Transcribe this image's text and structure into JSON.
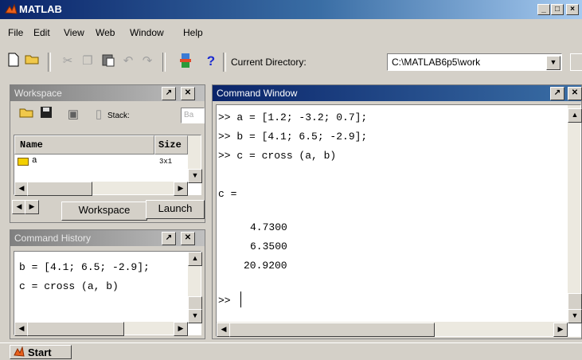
{
  "window": {
    "title": "MATLAB"
  },
  "menu": [
    {
      "label": "File",
      "key": "F",
      "rest": "ile"
    },
    {
      "label": "Edit",
      "key": "E",
      "rest": "dit"
    },
    {
      "label": "View",
      "key": "V",
      "rest": "iew"
    },
    {
      "label": "Web",
      "key": "",
      "rest": "We"
    },
    {
      "label": "Window",
      "key": "W",
      "rest": "indow"
    },
    {
      "label": "Help",
      "key": "H",
      "rest": "elp"
    }
  ],
  "toolbar": {
    "current_directory_label": "Current Directory:",
    "current_directory_value": "C:\\MATLAB6p5\\work"
  },
  "workspace": {
    "title": "Workspace",
    "stack_label": "Stack:",
    "stack_value": "Ba",
    "col_name": "Name",
    "col_size": "Size",
    "row_name": "a",
    "row_size": "3x1",
    "tab_workspace": "Workspace",
    "tab_launch": "Launch"
  },
  "history": {
    "title": "Command History",
    "lines": [
      "b = [4.1; 6.5; -2.9];",
      "c = cross (a, b)"
    ]
  },
  "command": {
    "title": "Command Window",
    "lines": [
      ">> a = [1.2; -3.2; 0.7];",
      ">> b = [4.1; 6.5; -2.9];",
      ">> c = cross (a, b)"
    ],
    "result_name": "c =",
    "results": [
      "4.7300",
      "6.3500",
      "20.9200"
    ],
    "prompt": ">>"
  },
  "taskbar": {
    "start": "Start"
  }
}
